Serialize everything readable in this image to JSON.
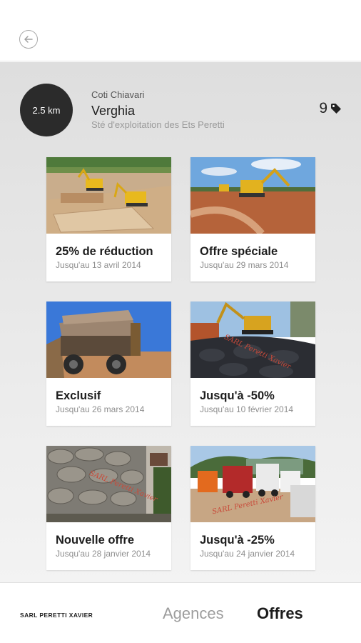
{
  "header": {
    "back_icon": "arrow-left-icon"
  },
  "agency": {
    "distance": "2.5 km",
    "city": "Coti Chiavari",
    "name": "Verghia",
    "company": "Sté d'exploitation des Ets Peretti",
    "offers_count": "9",
    "tag_icon": "tag-icon"
  },
  "offers": [
    {
      "title": "25% de réduction",
      "date": "Jusqu'au 13 avril 2014",
      "image": "excavators on building site"
    },
    {
      "title": "Offre spéciale",
      "date": "Jusqu'au 29 mars 2014",
      "image": "excavator on red earth with trucks"
    },
    {
      "title": "Exclusif",
      "date": "Jusqu'au 26 mars 2014",
      "image": "dump truck loaded with rocks"
    },
    {
      "title": "Jusqu'à -50%",
      "date": "Jusqu'au 10 février 2014",
      "image": "excavator and rock wall"
    },
    {
      "title": "Nouvelle offre",
      "date": "Jusqu'au 28 janvier 2014",
      "image": "stone retaining wall"
    },
    {
      "title": "Jusqu'à -25%",
      "date": "Jusqu'au 24 janvier 2014",
      "image": "trucks fleet in depot"
    }
  ],
  "watermark": "SARL Peretti Xavier",
  "footer": {
    "brand": "SARL PERETTI XAVIER",
    "tab_agences": "Agences",
    "tab_offres": "Offres"
  },
  "colors": {
    "badge": "#2b2b2b",
    "active_tab": "#1c1c1c",
    "inactive_tab": "#9d9d9d"
  }
}
